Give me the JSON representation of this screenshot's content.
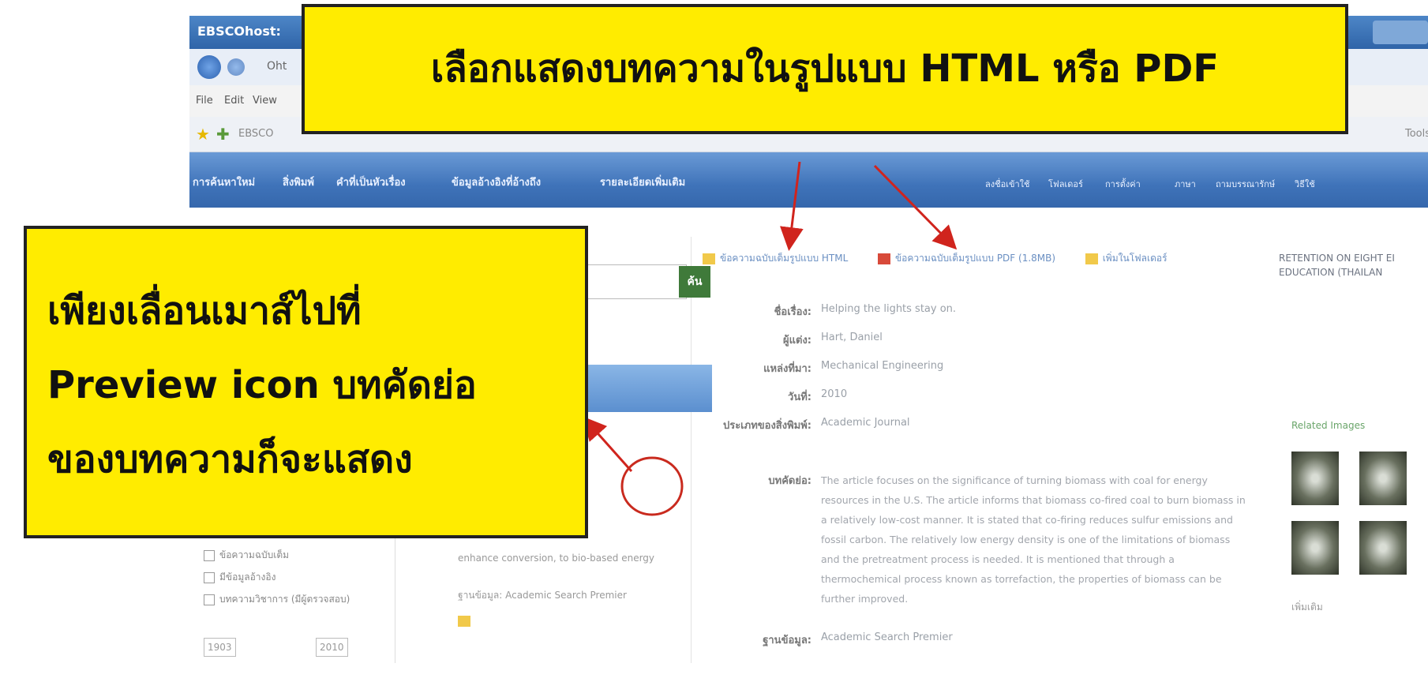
{
  "browser": {
    "title": "EBSCOhost: ",
    "address_text": "Oht",
    "menu": [
      "File",
      "Edit",
      "View"
    ],
    "fav_text": "EBSCO",
    "tools_label": "Tools"
  },
  "ebsco_nav": {
    "left_items": [
      "การค้นหาใหม่",
      "สิ่งพิมพ์",
      "คำที่เป็นหัวเรื่อง",
      "ข้อมูลอ้างอิงที่อ้างถึง",
      "รายละเอียดเพิ่มเติม"
    ],
    "right_items": [
      "ลงชื่อเข้าใช้",
      "โฟลเดอร์",
      "การตั้งค่า",
      "ภาษา",
      "ถามบรรณารักษ์",
      "วิธีใช้"
    ]
  },
  "callouts": {
    "top": "เลือกแสดงบทความในรูปแบบ HTML หรือ PDF",
    "left_lines": [
      "เพียงเลื่อนเมาส์ไปที่",
      "Preview icon บทคัดย่อ",
      "ของบทความก็จะแสดง"
    ]
  },
  "sidebar": {
    "go_button": "ค้น",
    "filters": [
      "ข้อความฉบับเต็ม",
      "มีข้อมูลอ้างอิง",
      "บทความวิชาการ (มีผู้ตรวจสอบ)"
    ],
    "year_from": "1903",
    "year_to": "2010"
  },
  "result": {
    "db_label": "ฐานข้อมูล: Academic Search Premier",
    "text_snippet": "enhance conversion, to bio-based energy"
  },
  "detail": {
    "links": [
      "ข้อความฉบับเต็มรูปแบบ HTML",
      "ข้อความฉบับเต็มรูปแบบ PDF (1.8MB)",
      "เพิ่มในโฟลเดอร์"
    ],
    "fields": [
      {
        "label": "ชื่อเรื่อง:",
        "value": "Helping the lights stay on."
      },
      {
        "label": "ผู้แต่ง:",
        "value": "Hart, Daniel"
      },
      {
        "label": "แหล่งที่มา:",
        "value": "Mechanical Engineering"
      },
      {
        "label": "วันที่:",
        "value": "2010"
      },
      {
        "label": "ประเภทของสิ่งพิมพ์:",
        "value": "Academic Journal"
      }
    ],
    "abstract_label": "บทคัดย่อ:",
    "abstract": "The article focuses on the significance of turning biomass with coal for energy resources in the U.S. The article informs that biomass co-fired coal to burn biomass in a relatively low-cost manner. It is stated that co-firing reduces sulfur emissions and fossil carbon. The relatively low energy density is one of the limitations of biomass and the pretreatment process is needed. It is mentioned that through a thermochemical process known as torrefaction, the properties of biomass can be further improved.",
    "database_label": "ฐานข้อมูล:",
    "database": "Academic Search Premier"
  },
  "right_panel": {
    "lines": [
      "RETENTION ON EIGHT EI",
      "EDUCATION (THAILAN"
    ],
    "related_images": "Related Images",
    "more": "เพิ่มเติม"
  },
  "colors": {
    "callout_bg": "#ffec00",
    "toolbar_blue": "#3f73b9",
    "arrow_red": "#d0241d"
  }
}
